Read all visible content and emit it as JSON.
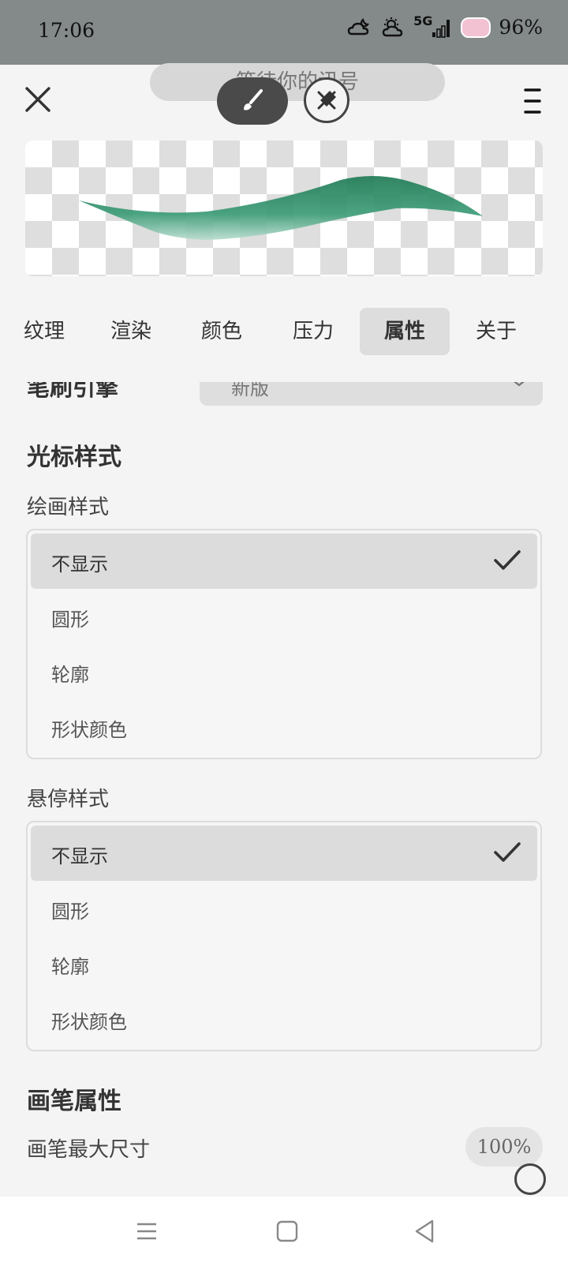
{
  "status_bar": {
    "time": "17:06",
    "icons": [
      "cloud-moon-icon",
      "cloud-sun-icon",
      "5g-signal-icon"
    ],
    "network": "5G",
    "battery": "96%"
  },
  "toast": {
    "text": "等待你的讯号"
  },
  "toolbar": {
    "close_icon": "close-icon",
    "brush_icon": "brush-icon",
    "eraser_icon": "eraser-icon",
    "menu_icon": "menu-icon"
  },
  "preview": {
    "stroke_color": "#2e8b66"
  },
  "tabs": [
    {
      "label": "纹理",
      "active": false
    },
    {
      "label": "渲染",
      "active": false
    },
    {
      "label": "颜色",
      "active": false
    },
    {
      "label": "压力",
      "active": false
    },
    {
      "label": "属性",
      "active": true
    },
    {
      "label": "关于",
      "active": false
    }
  ],
  "engine": {
    "label": "笔刷引擎",
    "value": "新版"
  },
  "cursor_section": {
    "title": "光标样式",
    "draw_style": {
      "label": "绘画样式",
      "options": [
        "不显示",
        "圆形",
        "轮廓",
        "形状颜色"
      ],
      "selected": "不显示"
    },
    "hover_style": {
      "label": "悬停样式",
      "options": [
        "不显示",
        "圆形",
        "轮廓",
        "形状颜色"
      ],
      "selected": "不显示"
    }
  },
  "brush_props": {
    "title": "画笔属性",
    "max_size_label": "画笔最大尺寸",
    "max_size_value": "100%"
  },
  "nav_bar": {
    "icons": [
      "recent-apps-icon",
      "home-icon",
      "back-icon"
    ]
  }
}
